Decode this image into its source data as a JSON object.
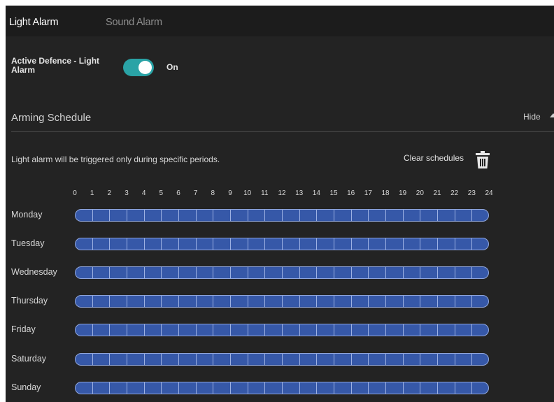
{
  "tabs": [
    {
      "label": "Light Alarm",
      "active": true
    },
    {
      "label": "Sound Alarm",
      "active": false
    }
  ],
  "active_defence": {
    "label": "Active Defence - Light Alarm",
    "state_label": "On",
    "enabled": true
  },
  "schedule": {
    "title": "Arming Schedule",
    "hide_label": "Hide",
    "description": "Light alarm will be triggered only during specific periods.",
    "clear_label": "Clear schedules",
    "hours": [
      "0",
      "1",
      "2",
      "3",
      "4",
      "5",
      "6",
      "7",
      "8",
      "9",
      "10",
      "11",
      "12",
      "13",
      "14",
      "15",
      "16",
      "17",
      "18",
      "19",
      "20",
      "21",
      "22",
      "23",
      "24"
    ],
    "days": [
      {
        "label": "Monday",
        "armed_hours": 24
      },
      {
        "label": "Tuesday",
        "armed_hours": 24
      },
      {
        "label": "Wednesday",
        "armed_hours": 24
      },
      {
        "label": "Thursday",
        "armed_hours": 24
      },
      {
        "label": "Friday",
        "armed_hours": 24
      },
      {
        "label": "Saturday",
        "armed_hours": 24
      },
      {
        "label": "Sunday",
        "armed_hours": 24
      }
    ]
  },
  "colors": {
    "background": "#232323",
    "tab_bar": "#1c1c1c",
    "toggle_on": "#2aa3a6",
    "schedule_fill": "#3658a8",
    "schedule_border": "#90a6dc"
  },
  "icons": {
    "trash": "trash-icon",
    "collapse": "chevron-up-icon"
  }
}
